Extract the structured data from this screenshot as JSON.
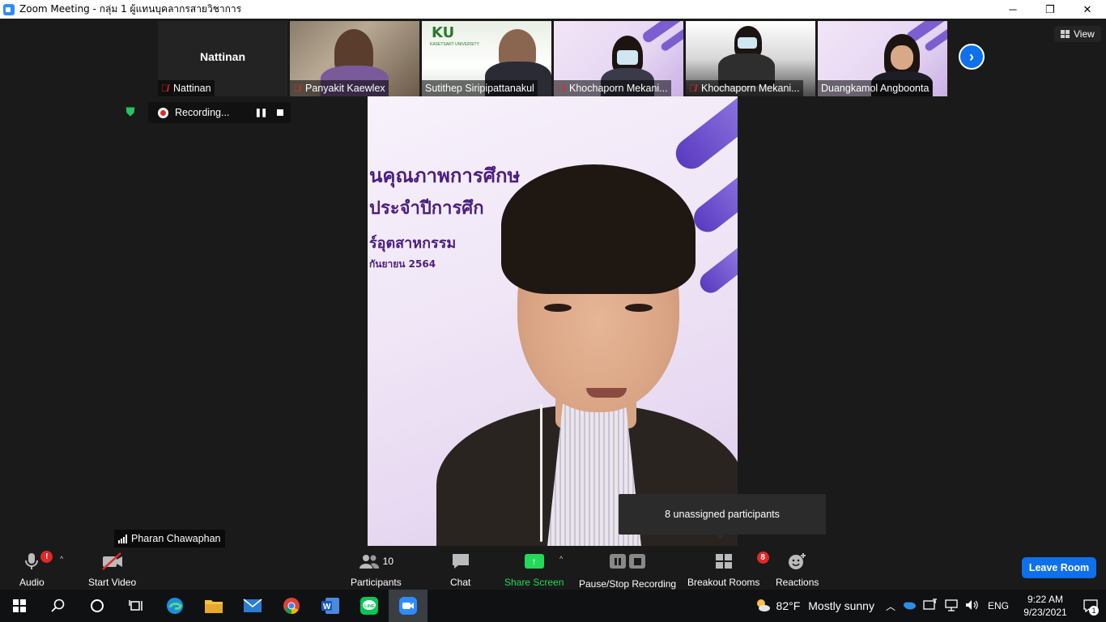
{
  "window": {
    "title": "Zoom Meeting - กลุ่ม 1 ผู้แทนบุคลากรสายวิชาการ",
    "minimize_icon": "─",
    "restore_icon": "❐",
    "close_icon": "✕"
  },
  "thumbnails": [
    {
      "name": "Nattinan",
      "big_name": "Nattinan",
      "muted": true
    },
    {
      "name": "Panyakit Kaewlex",
      "muted": true
    },
    {
      "name": "Sutithep Siripipattanakul",
      "muted": false,
      "logo": "KU",
      "logo_sub": "KASETSART UNIVERSITY"
    },
    {
      "name": "Khochaporn Mekani...",
      "muted": true
    },
    {
      "name": "Khochaporn Mekani...",
      "muted": true
    },
    {
      "name": "Duangkamol Angboonta",
      "muted": false
    }
  ],
  "view_button": {
    "label": "View"
  },
  "next_icon": "›",
  "recording": {
    "label": "Recording...",
    "pause_icon": "❚❚"
  },
  "main_video": {
    "slide_lines": [
      "นคุณภาพการศึกษ",
      "ประจำปีการศึก",
      "ร์อุตสาหกรรม",
      "กันยายน 2564"
    ]
  },
  "speaker": {
    "name": "Pharan Chawaphan"
  },
  "tooltip": {
    "text": "8 unassigned participants"
  },
  "toolbar": {
    "audio": {
      "label": "Audio",
      "badge": "!"
    },
    "video": {
      "label": "Start Video"
    },
    "participants": {
      "label": "Participants",
      "count": "10"
    },
    "chat": {
      "label": "Chat"
    },
    "share": {
      "label": "Share Screen"
    },
    "recording": {
      "label": "Pause/Stop Recording"
    },
    "breakout": {
      "label": "Breakout Rooms",
      "badge": "8"
    },
    "reactions": {
      "label": "Reactions"
    },
    "leave": {
      "label": "Leave Room"
    },
    "caret": "^"
  },
  "taskbar": {
    "weather_temp": "82°F",
    "weather_desc": "Mostly sunny",
    "lang": "ENG",
    "time": "9:22 AM",
    "date": "9/23/2021",
    "notif_count": "1",
    "apps": [
      "start-icon",
      "search-icon",
      "cortana-icon",
      "task-view-icon",
      "edge-icon",
      "file-explorer-icon",
      "mail-icon",
      "chrome-icon",
      "word-icon",
      "line-icon",
      "zoom-icon"
    ]
  },
  "colors": {
    "accent": "#0e71eb",
    "share_green": "#23d959",
    "alert_red": "#e02828",
    "shield_green": "#22c55e"
  }
}
